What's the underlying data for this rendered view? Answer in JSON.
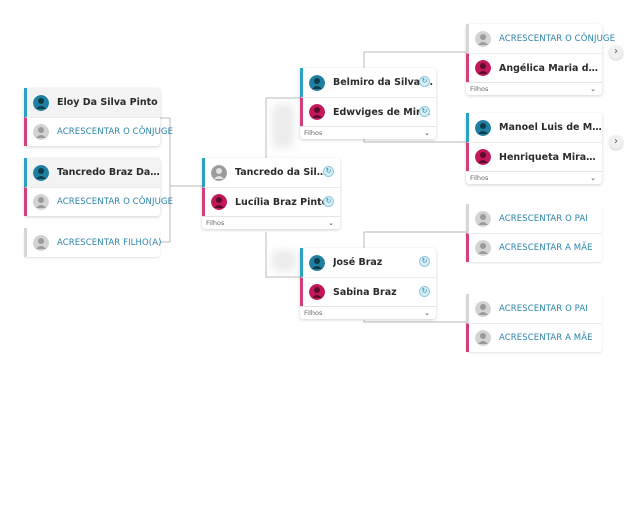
{
  "colors": {
    "male": "#2aa3c2",
    "female": "#d0417b",
    "neutral": "#d7d7d7",
    "link": "#2a84a8"
  },
  "left_group": {
    "eloy": {
      "name": "Eloy Da Silva Pinto",
      "spouse_action": "ACRESCENTAR O CÔNJUGE"
    },
    "tancredo_braz": {
      "name": "Tancredo Braz Da Silva",
      "spouse_action": "ACRESCENTAR O CÔNJUGE"
    },
    "add_child": "ACRESCENTAR FILHO(A)"
  },
  "focus": {
    "father": "Tancredo da Silva Pin...",
    "mother": "Lucília Braz Pinto",
    "children_label": "Filhos"
  },
  "parents_paternal": {
    "father": "Belmiro da Silva Pinto",
    "mother": "Edwviges de Miranda",
    "children_label": "Filhos"
  },
  "parents_maternal": {
    "father": "José Braz",
    "mother": "Sabina Braz",
    "children_label": "Filhos"
  },
  "gp1": {
    "spouse_action": "ACRESCENTAR O CÔNJUGE",
    "name": "Angélica Maria da Apar...",
    "children_label": "Filhos"
  },
  "gp2": {
    "father": "Manoel Luis de Miranda",
    "mother": "Henriqueta Miranda",
    "children_label": "Filhos"
  },
  "gp3": {
    "add_father": "ACRESCENTAR O PAI",
    "add_mother": "ACRESCENTAR A MÃE"
  },
  "gp4": {
    "add_father": "ACRESCENTAR O PAI",
    "add_mother": "ACRESCENTAR A MÃE"
  },
  "icons": {
    "expand": "chevron-right-icon",
    "dropdown": "chevron-down-icon",
    "edit": "edit-badge-icon"
  }
}
